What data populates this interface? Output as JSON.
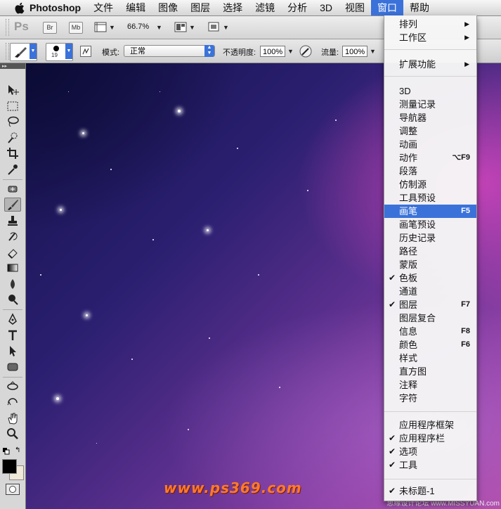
{
  "menubar": {
    "app": "Photoshop",
    "items": [
      "文件",
      "编辑",
      "图像",
      "图层",
      "选择",
      "滤镜",
      "分析",
      "3D",
      "视图",
      "窗口",
      "帮助"
    ]
  },
  "options1": {
    "ps_logo": "Ps",
    "br": "Br",
    "mb": "Mb",
    "zoom": "66.7%"
  },
  "options2": {
    "brush_size": "19",
    "mode_label": "模式:",
    "mode_value": "正常",
    "opacity_label": "不透明度:",
    "opacity_value": "100%",
    "flow_label": "流量:",
    "flow_value": "100%"
  },
  "canvas": {
    "watermark": "www.ps369.com",
    "credit": "思缘设计论坛 www.MISSYUAN.com"
  },
  "window_menu": {
    "g1": [
      "排列",
      "工作区"
    ],
    "g2": [
      "扩展功能"
    ],
    "g3": [
      {
        "label": "3D",
        "shortcut": "",
        "checked": false
      },
      {
        "label": "测量记录",
        "shortcut": "",
        "checked": false
      },
      {
        "label": "导航器",
        "shortcut": "",
        "checked": false
      },
      {
        "label": "调整",
        "shortcut": "",
        "checked": false
      },
      {
        "label": "动画",
        "shortcut": "",
        "checked": false
      },
      {
        "label": "动作",
        "shortcut": "⌥F9",
        "checked": false
      },
      {
        "label": "段落",
        "shortcut": "",
        "checked": false
      },
      {
        "label": "仿制源",
        "shortcut": "",
        "checked": false
      },
      {
        "label": "工具预设",
        "shortcut": "",
        "checked": false
      },
      {
        "label": "画笔",
        "shortcut": "F5",
        "checked": false,
        "highlighted": true
      },
      {
        "label": "画笔预设",
        "shortcut": "",
        "checked": false
      },
      {
        "label": "历史记录",
        "shortcut": "",
        "checked": false
      },
      {
        "label": "路径",
        "shortcut": "",
        "checked": false
      },
      {
        "label": "蒙版",
        "shortcut": "",
        "checked": false
      },
      {
        "label": "色板",
        "shortcut": "",
        "checked": true
      },
      {
        "label": "通道",
        "shortcut": "",
        "checked": false
      },
      {
        "label": "图层",
        "shortcut": "F7",
        "checked": true
      },
      {
        "label": "图层复合",
        "shortcut": "",
        "checked": false
      },
      {
        "label": "信息",
        "shortcut": "F8",
        "checked": false
      },
      {
        "label": "颜色",
        "shortcut": "F6",
        "checked": false
      },
      {
        "label": "样式",
        "shortcut": "",
        "checked": false
      },
      {
        "label": "直方图",
        "shortcut": "",
        "checked": false
      },
      {
        "label": "注释",
        "shortcut": "",
        "checked": false
      },
      {
        "label": "字符",
        "shortcut": "",
        "checked": false
      }
    ],
    "g4": [
      {
        "label": "应用程序框架",
        "checked": false
      },
      {
        "label": "应用程序栏",
        "checked": true
      },
      {
        "label": "选项",
        "checked": true
      },
      {
        "label": "工具",
        "checked": true
      }
    ],
    "g5": [
      {
        "label": "未标题-1",
        "checked": true
      }
    ]
  },
  "colors": {
    "accent": "#3b72d9",
    "foreground_color": "#000000",
    "background_color": "#f0e8d8"
  }
}
